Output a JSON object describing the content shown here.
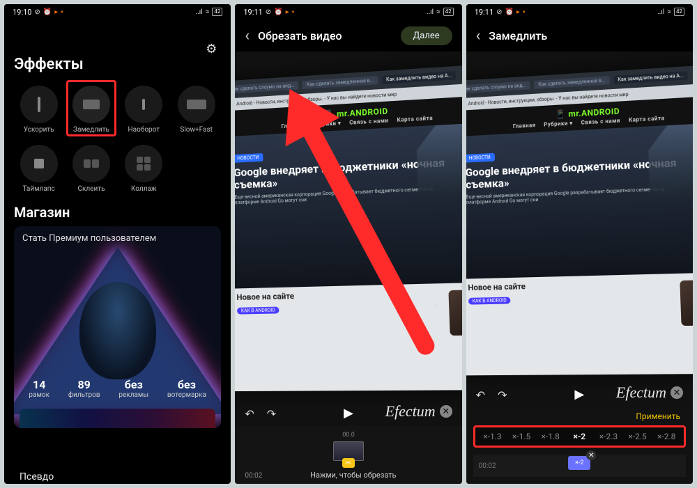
{
  "status": {
    "time1": "19:10",
    "time2": "19:11",
    "time3": "19:11",
    "batt": "42",
    "signal": "..ıl",
    "wifi": "≈"
  },
  "screen1": {
    "title": "Эффекты",
    "settings": "⚙",
    "effects": [
      {
        "label": "Ускорить"
      },
      {
        "label": "Замедлить",
        "highlight": true
      },
      {
        "label": "Наоборот"
      },
      {
        "label": "Slow+Fast"
      },
      {
        "label": "Таймлапс"
      },
      {
        "label": "Склеить"
      },
      {
        "label": "Коллаж"
      }
    ],
    "section2": "Магазин",
    "premium": {
      "title": "Стать Премиум пользователем",
      "stats": [
        {
          "num": "14",
          "lbl": "рамок"
        },
        {
          "num": "89",
          "lbl": "фильтров"
        },
        {
          "num": "без",
          "lbl": "рекламы"
        },
        {
          "num": "без",
          "lbl": "вотермарка"
        }
      ]
    },
    "pseudo": "Псевдо"
  },
  "screen2": {
    "title": "Обрезать видео",
    "next": "Далее",
    "site": {
      "addr": "Mr. Android - Новости, инструкции, обзоры. - У нас вы найдете новости мир",
      "logo": "mr.ANDROID",
      "nav": [
        "Главная",
        "Рубрики ▾",
        "Связь с нами",
        "Карта сайта"
      ],
      "heroBadge": "НОВОСТИ",
      "heroTitle": "Google внедряет в бюджетники «ночная съемка»",
      "heroSub": "Еще весной американская корпорация Google разрабатывает бюджетного сегмента на платформе Android Go могут сни",
      "sec2": "Новое на сайте",
      "sec2Badge": "КАК В ANDROID"
    },
    "watermark": "Efectum",
    "ts_center": "00.0",
    "duration": "00:02",
    "caption": "Нажми, чтобы обрезать"
  },
  "screen3": {
    "title": "Замедлить",
    "apply": "Применить",
    "speeds": [
      "×-1.3",
      "×-1.5",
      "×-1.8",
      "×-2",
      "×-2.3",
      "×-2.5",
      "×-2.8"
    ],
    "sel": 3,
    "chip": "×-2",
    "startTime": "00:02"
  }
}
